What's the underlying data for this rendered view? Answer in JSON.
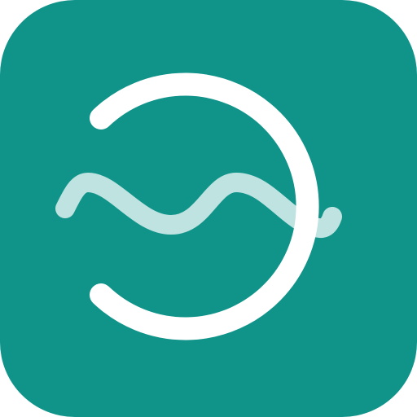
{
  "app_icon": {
    "icon_name": "sound-wave-arc-logo-icon",
    "colors": {
      "tile_background": "#10948A",
      "arc_stroke": "#FFFFFF",
      "wave_stroke": "#BFE3E0",
      "page_background": "#FFFFFF"
    }
  }
}
